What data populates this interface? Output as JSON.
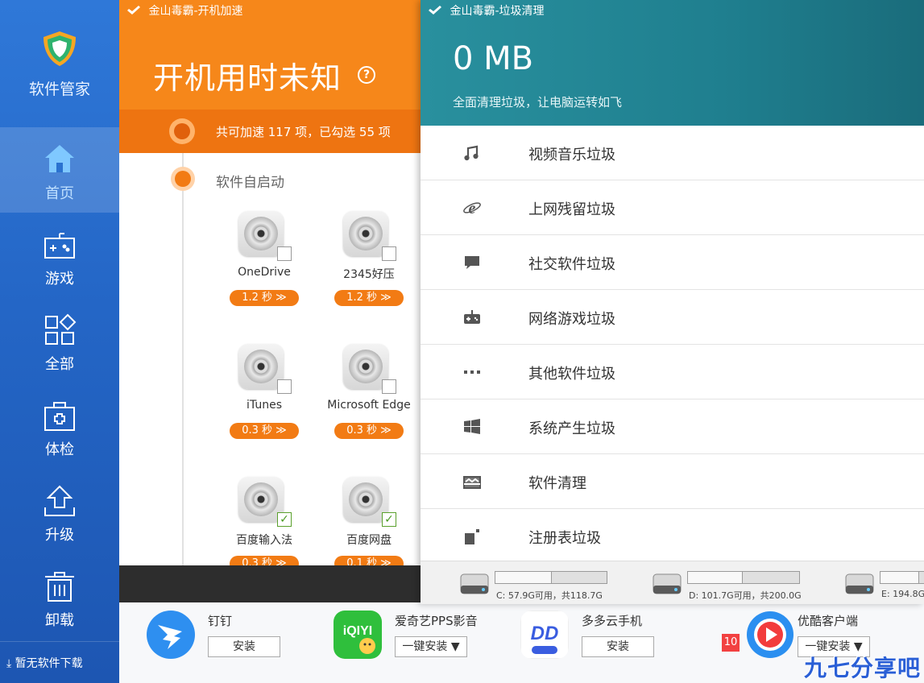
{
  "sidebar": {
    "app_name": "软件管家",
    "items": [
      {
        "label": "首页",
        "icon": "home-icon",
        "active": true
      },
      {
        "label": "游戏",
        "icon": "gamepad-icon"
      },
      {
        "label": "全部",
        "icon": "apps-grid-icon"
      },
      {
        "label": "体检",
        "icon": "medical-kit-icon"
      },
      {
        "label": "升级",
        "icon": "upload-arrow-icon"
      },
      {
        "label": "卸载",
        "icon": "trash-icon"
      }
    ],
    "download_status": "暂无软件下载"
  },
  "boost_window": {
    "title": "金山毒霸-开机加速",
    "headline": "开机用时未知",
    "help_glyph": "?",
    "summary": "共可加速 117 项，已勾选 55 项",
    "section": "软件自启动",
    "apps": [
      {
        "name": "OneDrive",
        "time": "1.2 秒 ≫",
        "checked": false
      },
      {
        "name": "2345好压",
        "time": "1.2 秒 ≫",
        "checked": false
      },
      {
        "name": "iTunes",
        "time": "0.3 秒 ≫",
        "checked": false
      },
      {
        "name": "Microsoft Edge",
        "time": "0.3 秒 ≫",
        "checked": false
      },
      {
        "name": "百度输入法",
        "time": "0.3 秒 ≫",
        "checked": true
      },
      {
        "name": "百度网盘",
        "time": "0.1 秒 ≫",
        "checked": true
      }
    ],
    "check_glyph": "✓"
  },
  "junk_window": {
    "title": "金山毒霸-垃圾清理",
    "size": "0 MB",
    "subtitle": "全面清理垃圾，让电脑运转如飞",
    "categories": [
      {
        "label": "视频音乐垃圾",
        "icon": "music-note-icon"
      },
      {
        "label": "上网残留垃圾",
        "icon": "ie-browser-icon"
      },
      {
        "label": "社交软件垃圾",
        "icon": "chat-bubble-icon"
      },
      {
        "label": "网络游戏垃圾",
        "icon": "game-controller-icon"
      },
      {
        "label": "其他软件垃圾",
        "icon": "more-dots-icon"
      },
      {
        "label": "系统产生垃圾",
        "icon": "windows-logo-icon"
      },
      {
        "label": "软件清理",
        "icon": "software-box-icon"
      },
      {
        "label": "注册表垃圾",
        "icon": "registry-icon"
      }
    ],
    "drives": [
      {
        "info": "C: 57.9G可用，共118.7G",
        "used_fraction": 0.51
      },
      {
        "info": "D: 101.7G可用，共200.0G",
        "used_fraction": 0.49
      },
      {
        "info": "E: 194.8G",
        "used_fraction": 0.35
      }
    ]
  },
  "recommended_apps": [
    {
      "name": "钉钉",
      "action": "安装",
      "icon": "dingtalk-icon"
    },
    {
      "name": "爱奇艺PPS影音",
      "action": "一键安装 ▼",
      "icon": "iqiyi-icon"
    },
    {
      "name": "多多云手机",
      "action": "安装",
      "icon": "duoduo-cloud-icon"
    },
    {
      "name": "优酷客户端",
      "action": "一键安装 ▼",
      "icon": "youku-icon",
      "badge": "10"
    }
  ],
  "watermark": "九七分享吧",
  "colors": {
    "sidebar": "#2466c6",
    "boost_orange": "#f6871a",
    "junk_teal": "#1f7f8f",
    "time_pill": "#f27b14"
  }
}
